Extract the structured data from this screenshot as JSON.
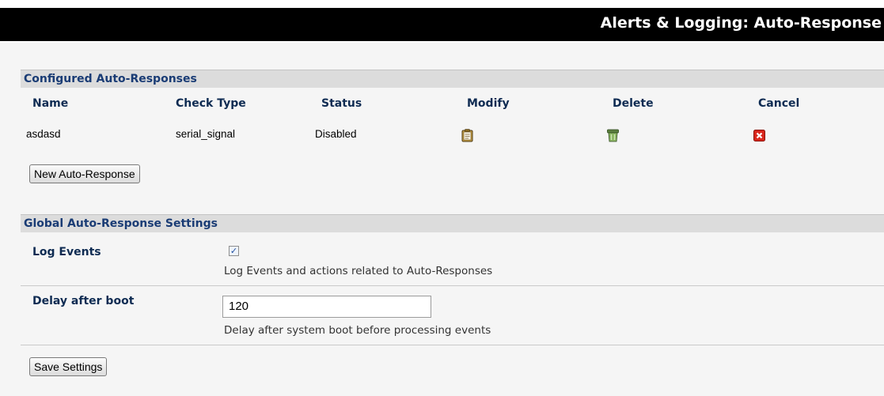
{
  "header": {
    "title": "Alerts & Logging: Auto-Response"
  },
  "configured": {
    "heading": "Configured Auto-Responses",
    "columns": [
      "Name",
      "Check Type",
      "Status",
      "Modify",
      "Delete",
      "Cancel"
    ],
    "rows": [
      {
        "name": "asdasd",
        "check_type": "serial_signal",
        "status": "Disabled",
        "modify_icon": "clipboard-icon",
        "delete_icon": "trash-icon",
        "cancel_icon": "close-icon"
      }
    ],
    "new_button": "New Auto-Response"
  },
  "global": {
    "heading": "Global Auto-Response Settings",
    "log_events": {
      "label": "Log Events",
      "checked": true,
      "help": "Log Events and actions related to Auto-Responses"
    },
    "delay_after_boot": {
      "label": "Delay after boot",
      "value": "120",
      "help": "Delay after system boot before processing events"
    },
    "save_button": "Save Settings"
  },
  "colors": {
    "title_bar": "#000000",
    "section_header_bg": "#dcdcdc",
    "section_header_text": "#1a3c75",
    "cancel_red": "#d9261c"
  }
}
